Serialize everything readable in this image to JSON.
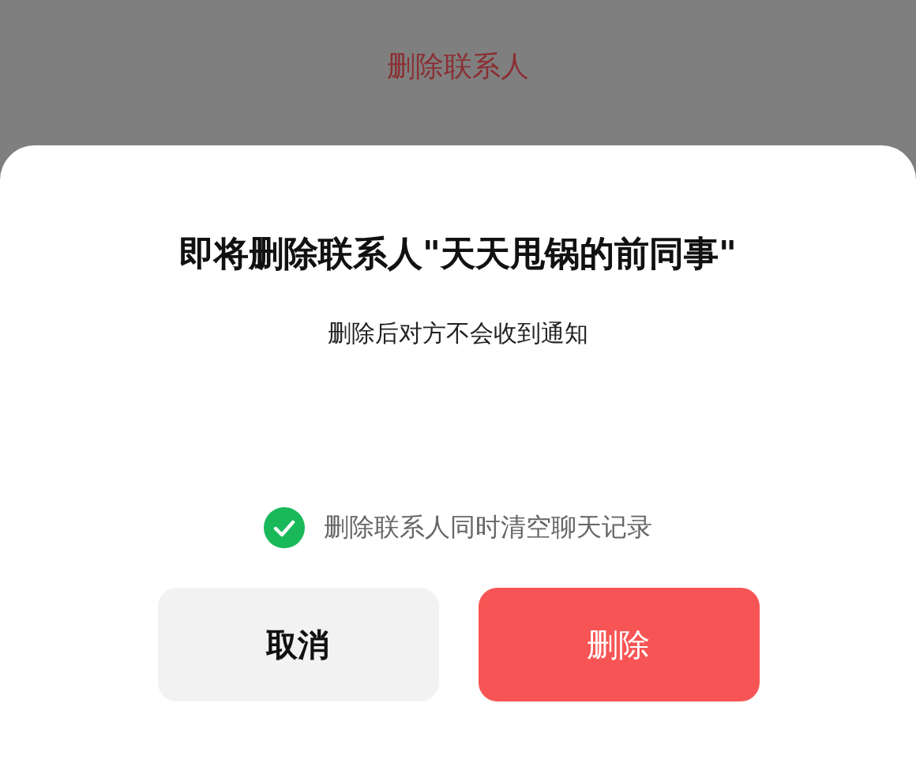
{
  "background_page": {
    "title": "删除联系人"
  },
  "dialog": {
    "title": "即将删除联系人\"天天甩锅的前同事\"",
    "subtitle": "删除后对方不会收到通知",
    "option": {
      "label": "删除联系人同时清空聊天记录",
      "checked": true
    },
    "buttons": [
      {
        "label": "取消",
        "kind": "cancel"
      },
      {
        "label": "删除",
        "kind": "danger"
      }
    ]
  }
}
